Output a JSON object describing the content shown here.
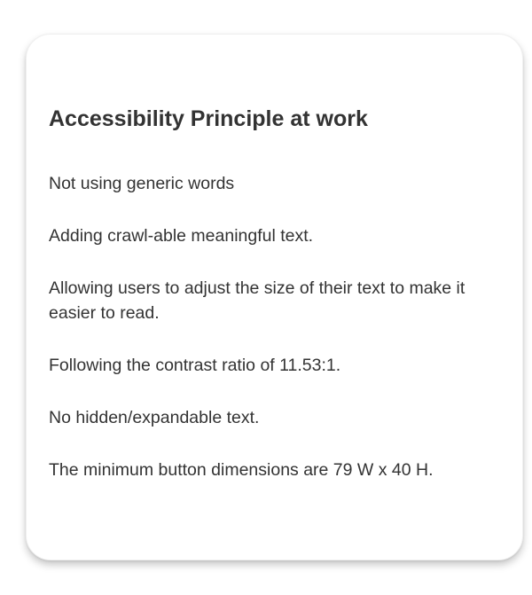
{
  "card": {
    "title": "Accessibility Principle at work",
    "items": [
      "Not using generic words",
      "Adding crawl-able meaningful text.",
      "Allowing users to adjust the size of their text to make it easier to read.",
      "Following the contrast ratio of 11.53:1.",
      "No hidden/expandable text.",
      "The minimum button dimensions are 79 W x 40 H."
    ]
  }
}
